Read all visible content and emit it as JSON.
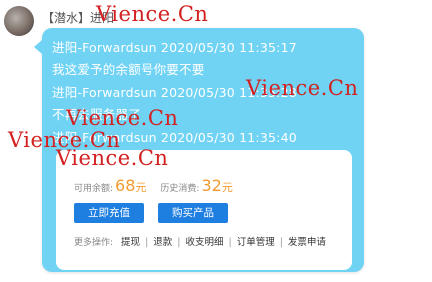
{
  "user": {
    "name": "【潜水】进阳"
  },
  "messages": [
    "进阳-Forwardsun 2020/05/30 11:35:17",
    "我这爱予的余额号你要不要",
    "进阳-Forwardsun 2020/05/30 11:35:28",
    "不再去服务器了",
    "进阳-Forwardsun 2020/05/30 11:35:40"
  ],
  "account_card": {
    "available_label": "可用余额:",
    "available_value": "68",
    "available_unit": "元",
    "history_label": "历史消费:",
    "history_value": "32",
    "history_unit": "元",
    "recharge_button": "立即充值",
    "buy_button": "购买产品",
    "more_ops_label": "更多操作:",
    "ops": [
      "提现",
      "退款",
      "收支明细",
      "订单管理",
      "发票申请"
    ]
  },
  "watermark": "Vience.Cn",
  "colors": {
    "bubble": "#70d3f4",
    "button": "#1f7fe0",
    "amount": "#f39b2f",
    "watermark": "#d32020"
  }
}
